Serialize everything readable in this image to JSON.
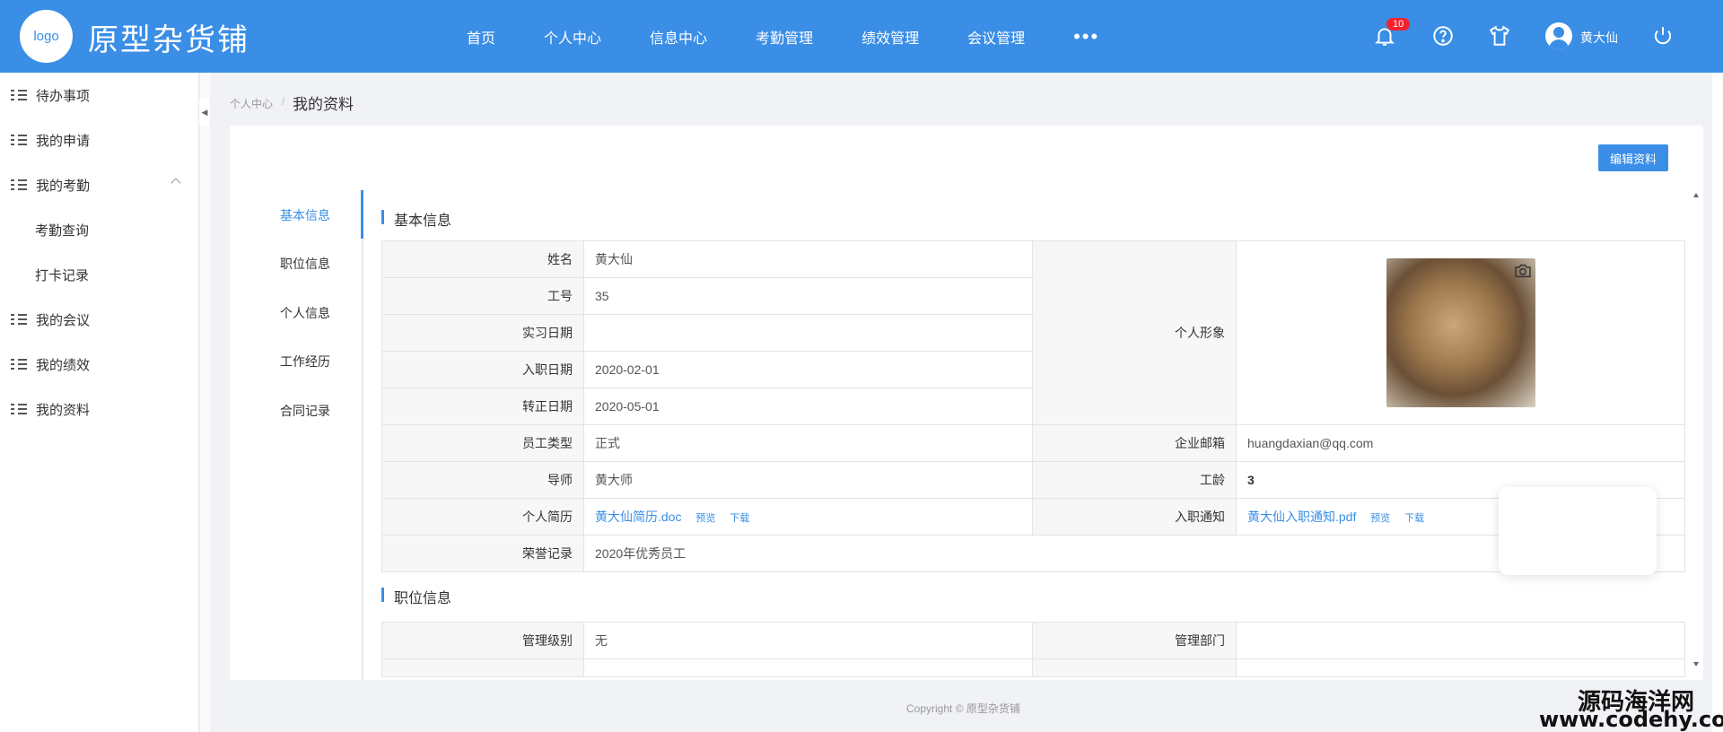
{
  "header": {
    "logo_text": "logo",
    "app_title": "原型杂货铺",
    "nav": [
      "首页",
      "个人中心",
      "信息中心",
      "考勤管理",
      "绩效管理",
      "会议管理"
    ],
    "more": "•••",
    "notification_count": "10",
    "user_name": "黄大仙",
    "accent_color": "#3a8ee6"
  },
  "sidebar": {
    "items": [
      {
        "label": "待办事项"
      },
      {
        "label": "我的申请"
      },
      {
        "label": "我的考勤"
      },
      {
        "label": "考勤查询"
      },
      {
        "label": "打卡记录"
      },
      {
        "label": "我的会议"
      },
      {
        "label": "我的绩效"
      },
      {
        "label": "我的资料"
      }
    ]
  },
  "breadcrumb": {
    "parent": "个人中心",
    "separator": "/",
    "current": "我的资料"
  },
  "edit_button": "编辑资料",
  "tabs": [
    "基本信息",
    "职位信息",
    "个人信息",
    "工作经历",
    "合同记录"
  ],
  "basic": {
    "title": "基本信息",
    "name_label": "姓名",
    "name": "黄大仙",
    "id_label": "工号",
    "id": "35",
    "intern_label": "实习日期",
    "intern": "",
    "join_label": "入职日期",
    "join": "2020-02-01",
    "regular_label": "转正日期",
    "regular": "2020-05-01",
    "photo_label": "个人形象",
    "type_label": "员工类型",
    "type": "正式",
    "email_label": "企业邮箱",
    "email": "huangdaxian@qq.com",
    "mentor_label": "导师",
    "mentor": "黄大师",
    "years_label": "工龄",
    "years": "3",
    "resume_label": "个人简历",
    "resume": "黄大仙简历.doc",
    "notice_label": "入职通知",
    "notice": "黄大仙入职通知.pdf",
    "preview": "预览",
    "download": "下载",
    "honor_label": "荣誉记录",
    "honor": "2020年优秀员工"
  },
  "position": {
    "title": "职位信息",
    "level_label": "管理级别",
    "level": "无",
    "dept_label": "管理部门",
    "dept": ""
  },
  "footer": "Copyright © 原型杂货铺",
  "watermark": {
    "line1": "源码海洋网",
    "line2": "www.codehy.com"
  }
}
